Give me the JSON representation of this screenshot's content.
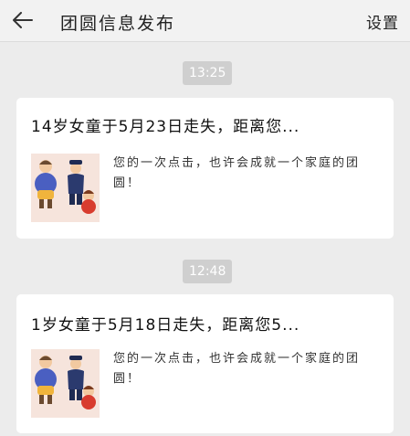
{
  "header": {
    "back_icon": "arrow-left-icon",
    "title": "团圆信息发布",
    "settings_label": "设置"
  },
  "messages": [
    {
      "time": "13:25",
      "title": "14岁女童于5月23日走失，距离您...",
      "description": "您的一次点击，也许会成就一个家庭的团圆！",
      "thumbnail_icon": "family-illustration-icon"
    },
    {
      "time": "12:48",
      "title": "1岁女童于5月18日走失，距离您5...",
      "description": "您的一次点击，也许会成就一个家庭的团圆！",
      "thumbnail_icon": "family-illustration-icon"
    }
  ],
  "colors": {
    "background": "#ececec",
    "header": "#f2f2f2",
    "card": "#ffffff",
    "time_badge": "#cfcfcf"
  }
}
